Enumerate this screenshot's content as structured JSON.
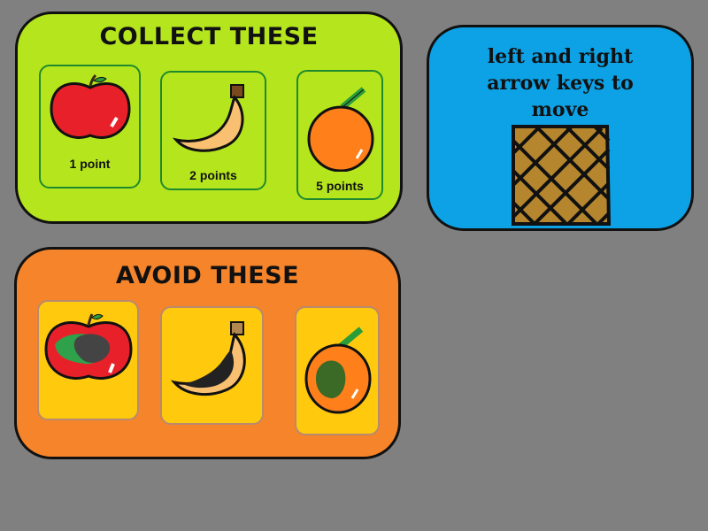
{
  "collect": {
    "title": "COLLECT THESE",
    "items": [
      {
        "fruit": "apple",
        "label": "1 point"
      },
      {
        "fruit": "banana",
        "label": "2 points"
      },
      {
        "fruit": "orange",
        "label": "5 points"
      }
    ]
  },
  "avoid": {
    "title": "AVOID THESE",
    "items": [
      {
        "fruit": "rotten-apple"
      },
      {
        "fruit": "rotten-banana"
      },
      {
        "fruit": "rotten-orange"
      }
    ]
  },
  "controls": {
    "text": "left and right arrow keys to move",
    "icon": "basket-icon"
  },
  "colors": {
    "background": "#808080",
    "collect_panel": "#b5e51d",
    "avoid_panel": "#f5842a",
    "controls_panel": "#0da2e6",
    "avoid_card": "#ffc90e"
  }
}
